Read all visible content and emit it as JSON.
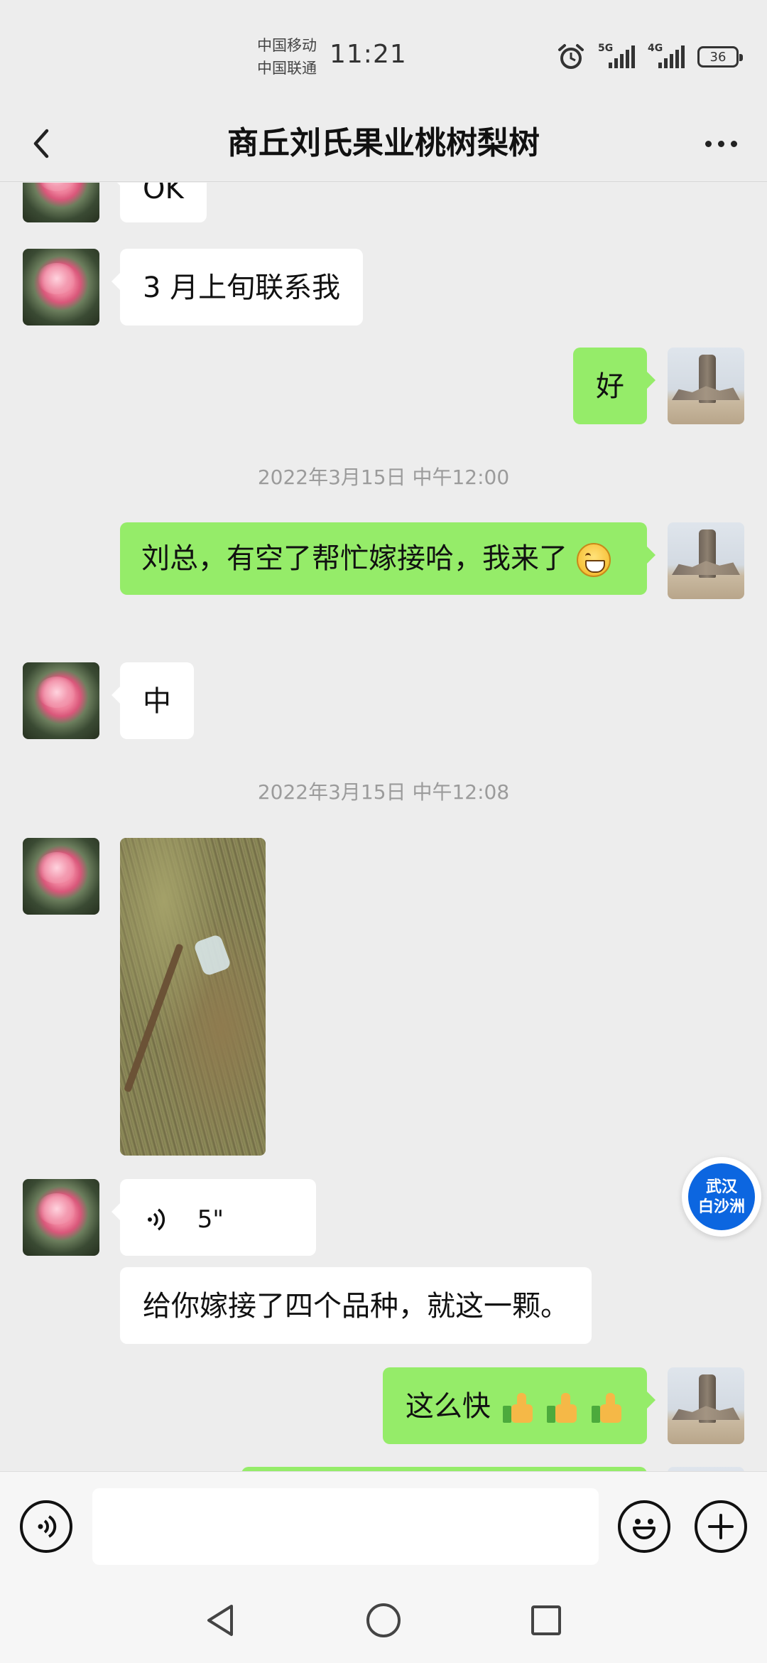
{
  "status_bar": {
    "carrier_1": "中国移动",
    "carrier_2": "中国联通",
    "time": "11:21",
    "signal_1_label": "5G",
    "signal_2_label": "4G",
    "battery": "36"
  },
  "header": {
    "title": "商丘刘氏果业桃树梨树"
  },
  "messages": {
    "m1_text": "OK",
    "m2_text": "3 月上旬联系我",
    "m3_text": "好",
    "ts1": "2022年3月15日 中午12:00",
    "m4_text": "刘总，有空了帮忙嫁接哈，我来了",
    "m5_text": "中",
    "ts2": "2022年3月15日 中午12:08",
    "m7_duration": "5\"",
    "m8_text": "给你嫁接了四个品种，就这一颗。",
    "m9_text": "这么快"
  },
  "floating_badge": {
    "line1": "武汉",
    "line2": "白沙洲"
  },
  "input_bar": {
    "placeholder": ""
  },
  "colors": {
    "background": "#ededed",
    "outgoing_bubble": "#95ec69",
    "incoming_bubble": "#ffffff",
    "badge_blue": "#0c66e0"
  },
  "icons": [
    "back-icon",
    "more-icon",
    "voice-icon",
    "emoji-icon",
    "plus-icon",
    "alarm-icon",
    "signal-icon",
    "battery-icon",
    "nav-back-icon",
    "nav-home-icon",
    "nav-recent-icon"
  ]
}
